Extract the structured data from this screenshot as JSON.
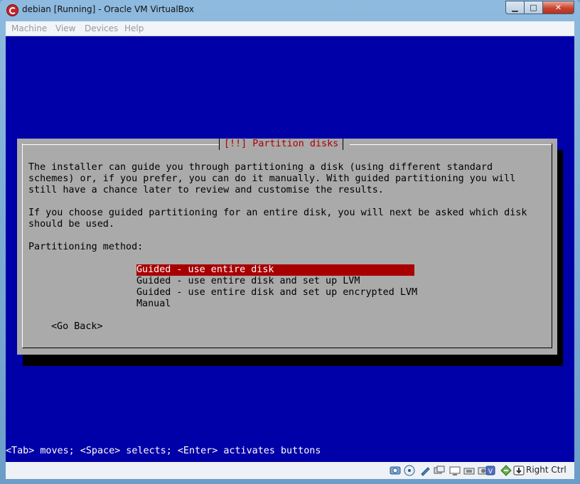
{
  "window": {
    "title": "debian [Running] - Oracle VM VirtualBox",
    "controls": {
      "minimize": "▁",
      "maximize": "□",
      "close": "✕"
    }
  },
  "menu": [
    "Machine",
    "View",
    "Devices",
    "Help"
  ],
  "dialog": {
    "title": "[!!] Partition disks",
    "paragraph1": [
      "The installer can guide you through partitioning a disk (using different standard",
      "schemes) or, if you prefer, you can do it manually. With guided partitioning you will",
      "still have a chance later to review and customise the results."
    ],
    "paragraph2": [
      "If you choose guided partitioning for an entire disk, you will next be asked which disk",
      "should be used."
    ],
    "method_label": "Partitioning method:",
    "options": [
      "Guided - use entire disk",
      "Guided - use entire disk and set up LVM",
      "Guided - use entire disk and set up encrypted LVM",
      "Manual"
    ],
    "selected_option": 0,
    "go_back": "<Go Back>"
  },
  "status_line": "<Tab> moves; <Space> selects; <Enter> activates buttons",
  "statusbar": {
    "icons": [
      "hard-disk-icon",
      "optical-drive-icon",
      "usb-icon",
      "shared-folders-icon",
      "display-icon",
      "network-icon",
      "recording-icon",
      "guest-additions-icon",
      "mouse-integration-icon",
      "keyboard-icon"
    ],
    "host_key": "Right Ctrl"
  },
  "colors": {
    "screen_bg": "#0000a8",
    "dialog_bg": "#aaaaaa",
    "title_text": "#aa0000",
    "selection_bg": "#a80000"
  }
}
